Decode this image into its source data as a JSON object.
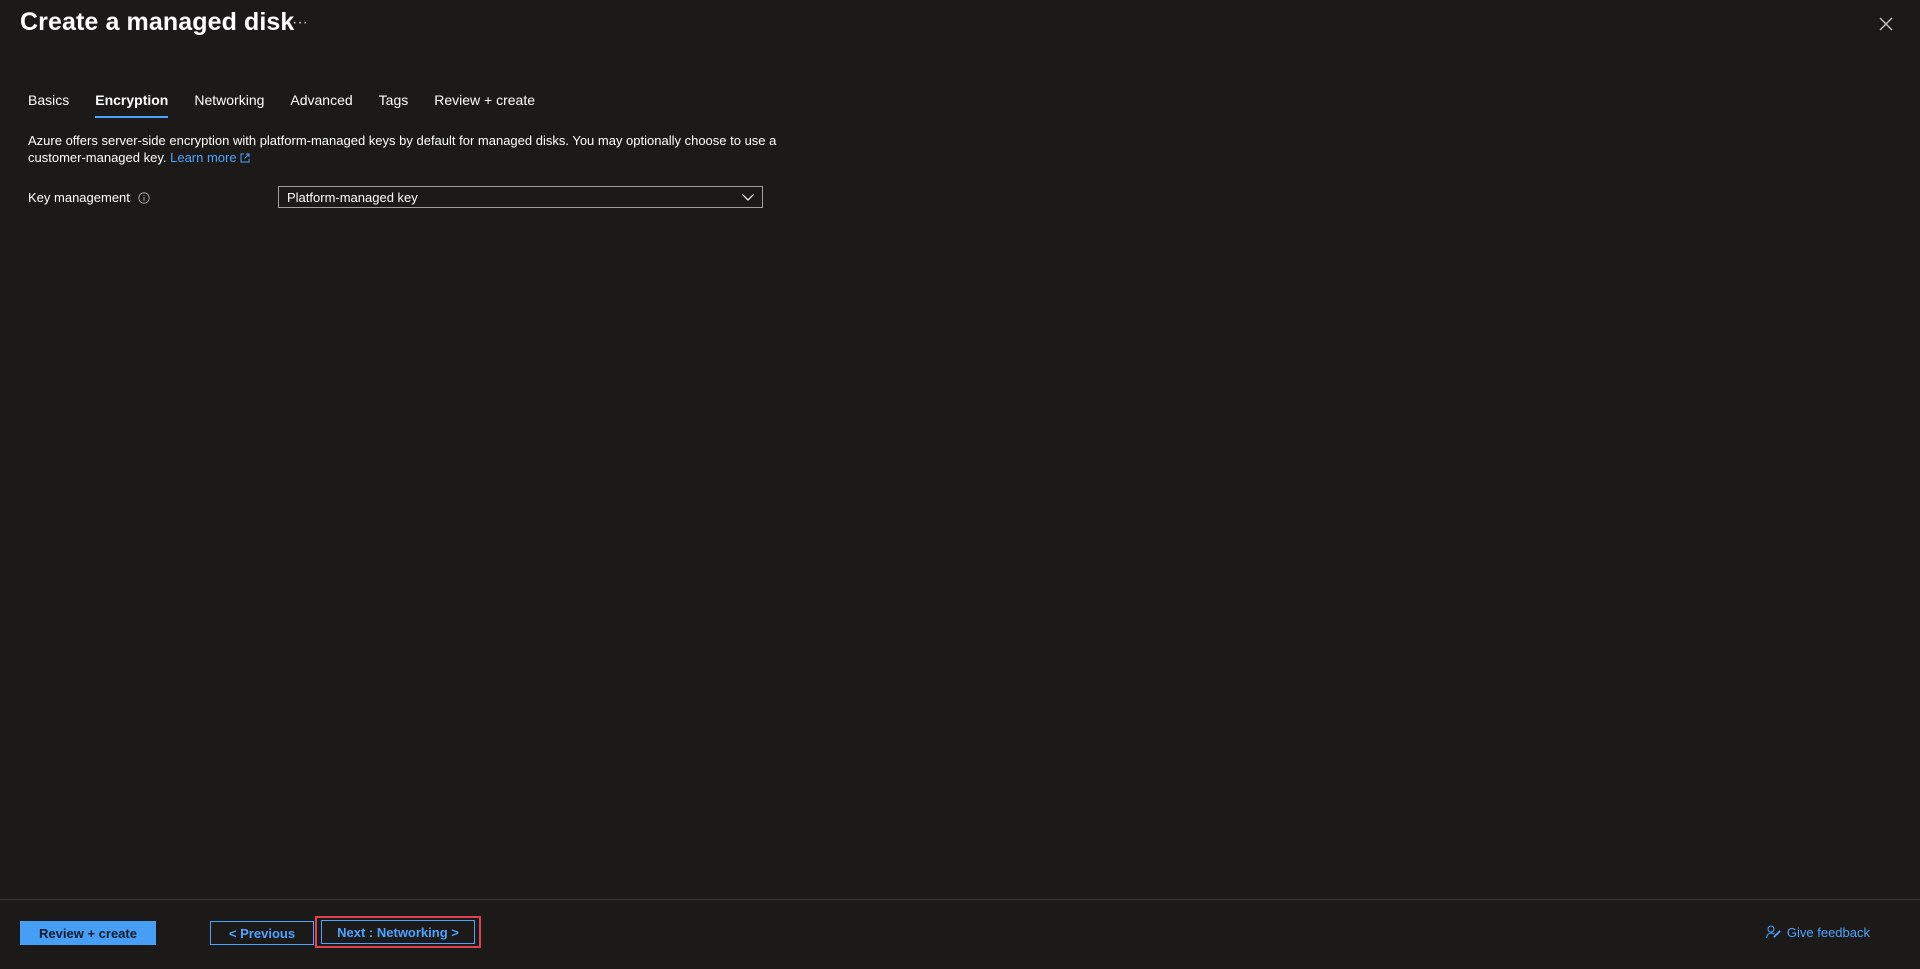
{
  "header": {
    "title": "Create a managed disk",
    "more_label": "···"
  },
  "tabs": [
    {
      "label": "Basics",
      "active": false
    },
    {
      "label": "Encryption",
      "active": true
    },
    {
      "label": "Networking",
      "active": false
    },
    {
      "label": "Advanced",
      "active": false
    },
    {
      "label": "Tags",
      "active": false
    },
    {
      "label": "Review + create",
      "active": false
    }
  ],
  "main": {
    "description": "Azure offers server-side encryption with platform-managed keys by default for managed disks. You may optionally choose to use a customer-managed key.",
    "learn_more": "Learn more",
    "key_management": {
      "label": "Key management",
      "value": "Platform-managed key"
    }
  },
  "footer": {
    "review_create": "Review + create",
    "previous": "< Previous",
    "next": "Next : Networking >",
    "feedback": "Give feedback"
  },
  "colors": {
    "background": "#1b1a19",
    "accent": "#4da3ff",
    "primary_button": "#479ef5",
    "highlight_border": "#e0434f"
  }
}
